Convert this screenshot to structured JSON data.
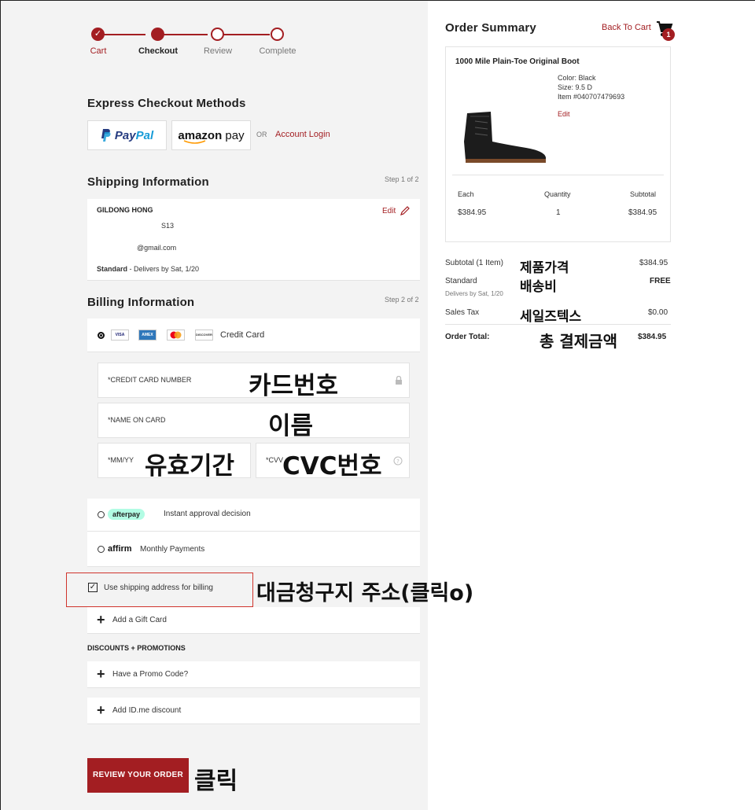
{
  "stepper": {
    "steps": [
      {
        "label": "Cart",
        "state": "done"
      },
      {
        "label": "Checkout",
        "state": "active"
      },
      {
        "label": "Review",
        "state": "todo"
      },
      {
        "label": "Complete",
        "state": "todo"
      }
    ],
    "done_mark": "✓"
  },
  "express": {
    "title": "Express Checkout Methods",
    "paypal_a": "Pay",
    "paypal_b": "Pal",
    "amazon_a": "amazon",
    "amazon_b": " pay",
    "or": "OR",
    "account_login": "Account Login"
  },
  "shipping": {
    "title": "Shipping Information",
    "step": "Step 1 of 2",
    "name": "GILDONG HONG",
    "edit": "Edit",
    "address_partial": "S13",
    "email_partial": "@gmail.com",
    "method": "Standard",
    "delivery": " - Delivers by Sat, 1/20"
  },
  "billing": {
    "title": "Billing Information",
    "step": "Step 2 of 2",
    "credit_card_label": "Credit Card",
    "card_logos": [
      "VISA",
      "AMEX",
      "MC",
      "DISCOVER"
    ],
    "fields": {
      "card_number": "*CREDIT CARD NUMBER",
      "name_on_card": "*NAME ON CARD",
      "mmyy": "*MM/YY",
      "cvv": "*CVV"
    },
    "afterpay_logo": "afterpay",
    "afterpay_text": "Instant approval decision",
    "affirm_logo": "affirm",
    "affirm_text": "Monthly Payments",
    "use_shipping": "Use shipping address for billing",
    "check_mark": "✓"
  },
  "annotations": {
    "card_number": "카드번호",
    "name": "이름",
    "expiry": "유효기간",
    "cvc": "CVC번호",
    "billing_address": "대금청구지 주소(클릭o)",
    "click": "클릭",
    "product_price": "제품가격",
    "shipping_fee": "배송비",
    "sales_tax": "세일즈텍스",
    "total": "총 결제금액"
  },
  "gift_card": "Add a Gift Card",
  "discounts": {
    "title": "DISCOUNTS + PROMOTIONS",
    "promo": "Have a Promo Code?",
    "idme": "Add ID.me discount"
  },
  "review_button": "REVIEW YOUR ORDER",
  "summary": {
    "title": "Order Summary",
    "back_to_cart": "Back To Cart",
    "cart_count": "1",
    "product": {
      "name": "1000 Mile Plain-Toe Original Boot",
      "color": "Color: Black",
      "size": "Size: 9.5 D",
      "item": "Item #040707479693",
      "edit": "Edit"
    },
    "columns": {
      "each": "Each",
      "quantity": "Quantity",
      "subtotal": "Subtotal"
    },
    "row": {
      "each": "$384.95",
      "quantity": "1",
      "subtotal": "$384.95"
    },
    "subtotal_label": "Subtotal (1 Item)",
    "subtotal_value": "$384.95",
    "shipping_label": "Standard",
    "shipping_sub": "Delivers by Sat, 1/20",
    "shipping_value": "FREE",
    "tax_label": "Sales Tax",
    "tax_value": "$0.00",
    "total_label": "Order Total:",
    "total_value": "$384.95"
  },
  "colors": {
    "brand": "#a31e22",
    "annotation_box": "#d0342c"
  }
}
